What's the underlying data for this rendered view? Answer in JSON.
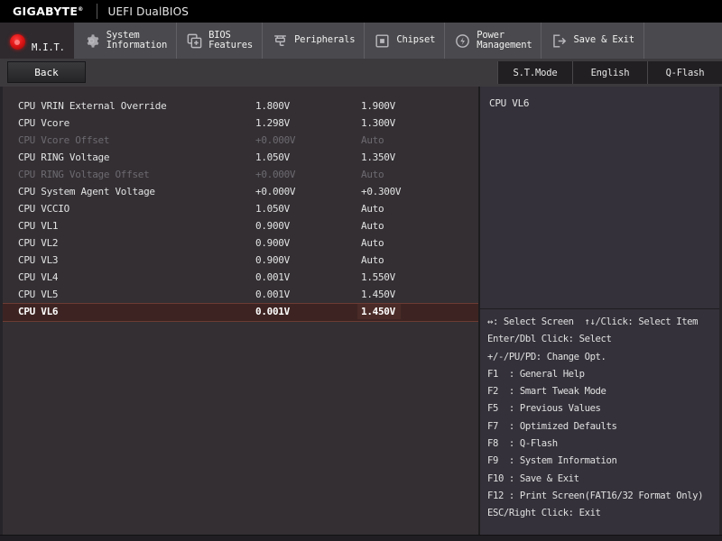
{
  "header": {
    "logo": "GIGABYTE",
    "trademark": "®",
    "subtitle": "UEFI DualBIOS"
  },
  "nav": {
    "tabs": [
      {
        "label": "M.I.T.",
        "icon": "bullseye-icon",
        "active": true
      },
      {
        "label": "System\nInformation",
        "icon": "gear-icon",
        "active": false
      },
      {
        "label": "BIOS\nFeatures",
        "icon": "chip-plus-icon",
        "active": false
      },
      {
        "label": "Peripherals",
        "icon": "plug-icon",
        "active": false
      },
      {
        "label": "Chipset",
        "icon": "chipset-icon",
        "active": false
      },
      {
        "label": "Power\nManagement",
        "icon": "power-bolt-icon",
        "active": false
      },
      {
        "label": "Save & Exit",
        "icon": "exit-arrow-icon",
        "active": false
      }
    ]
  },
  "toolbar": {
    "back_label": "Back",
    "right_buttons": [
      {
        "label": "S.T.Mode"
      },
      {
        "label": "English"
      },
      {
        "label": "Q-Flash"
      }
    ]
  },
  "settings": {
    "rows": [
      {
        "name": "CPU VRIN External Override",
        "current": "1.800V",
        "value": "1.900V",
        "disabled": false,
        "selected": false
      },
      {
        "name": "CPU Vcore",
        "current": "1.298V",
        "value": "1.300V",
        "disabled": false,
        "selected": false
      },
      {
        "name": "CPU Vcore Offset",
        "current": "+0.000V",
        "value": "Auto",
        "disabled": true,
        "selected": false
      },
      {
        "name": "CPU RING Voltage",
        "current": "1.050V",
        "value": "1.350V",
        "disabled": false,
        "selected": false
      },
      {
        "name": "CPU RING Voltage Offset",
        "current": "+0.000V",
        "value": "Auto",
        "disabled": true,
        "selected": false
      },
      {
        "name": "CPU System Agent Voltage",
        "current": "+0.000V",
        "value": "+0.300V",
        "disabled": false,
        "selected": false
      },
      {
        "name": "CPU VCCIO",
        "current": "1.050V",
        "value": "Auto",
        "disabled": false,
        "selected": false
      },
      {
        "name": "CPU VL1",
        "current": "0.900V",
        "value": "Auto",
        "disabled": false,
        "selected": false
      },
      {
        "name": "CPU VL2",
        "current": "0.900V",
        "value": "Auto",
        "disabled": false,
        "selected": false
      },
      {
        "name": "CPU VL3",
        "current": "0.900V",
        "value": "Auto",
        "disabled": false,
        "selected": false
      },
      {
        "name": "CPU VL4",
        "current": "0.001V",
        "value": "1.550V",
        "disabled": false,
        "selected": false
      },
      {
        "name": "CPU VL5",
        "current": "0.001V",
        "value": "1.450V",
        "disabled": false,
        "selected": false
      },
      {
        "name": "CPU VL6",
        "current": "0.001V",
        "value": "1.450V",
        "disabled": false,
        "selected": true
      }
    ]
  },
  "help": {
    "title": "CPU VL6",
    "keys": [
      "↔: Select Screen  ↑↓/Click: Select Item",
      "Enter/Dbl Click: Select",
      "+/-/PU/PD: Change Opt.",
      "F1  : General Help",
      "F2  : Smart Tweak Mode",
      "F5  : Previous Values",
      "F7  : Optimized Defaults",
      "F8  : Q-Flash",
      "F9  : System Information",
      "F10 : Save & Exit",
      "F12 : Print Screen(FAT16/32 Format Only)",
      "ESC/Right Click: Exit"
    ]
  },
  "colors": {
    "background": "#332f33",
    "topbar": "#000000",
    "navbar": "#4a4a4e",
    "accent_red": "#e01616",
    "selected_row": "#3d2422",
    "disabled_text": "#6d6a70"
  }
}
